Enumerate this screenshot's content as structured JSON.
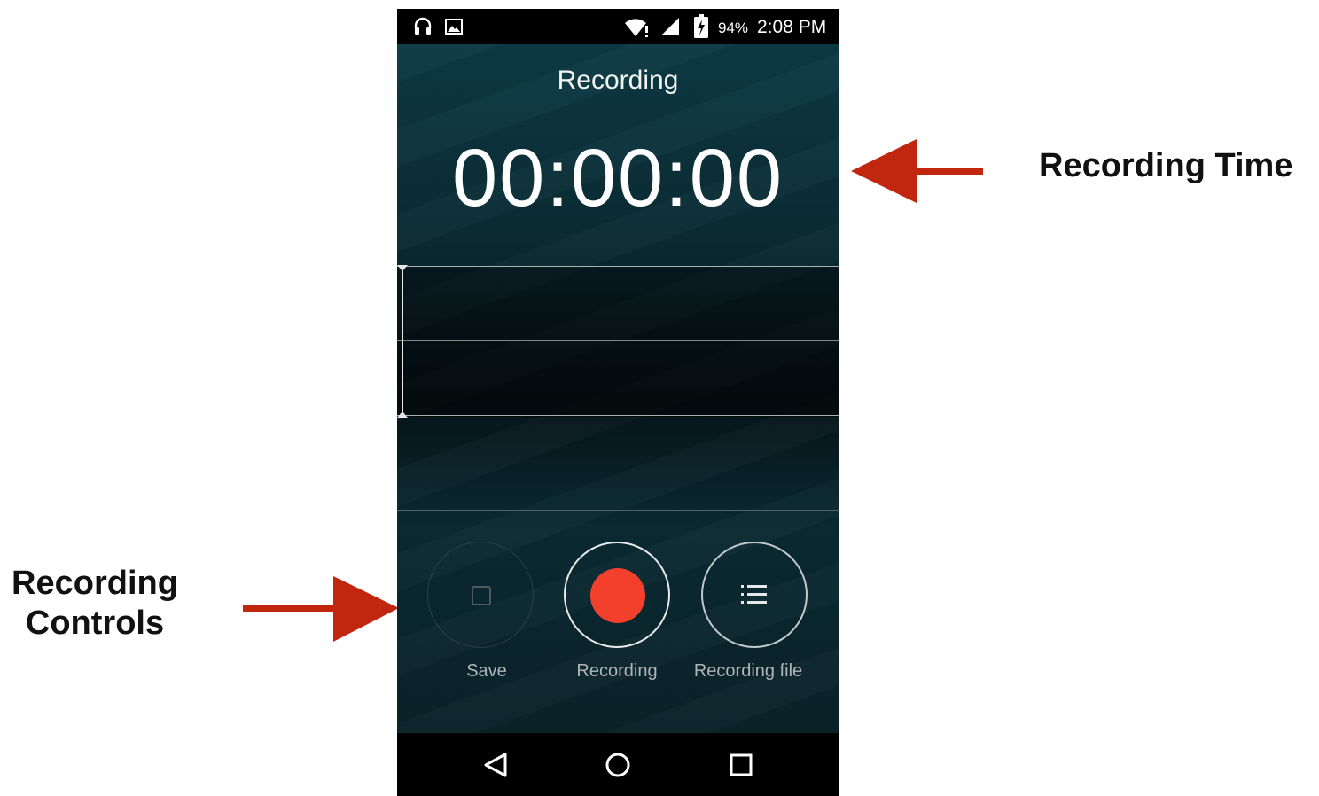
{
  "annotations": {
    "recording_time": "Recording Time",
    "recording_controls_line1": "Recording",
    "recording_controls_line2": "Controls",
    "arrow_color": "#c0270e"
  },
  "status_bar": {
    "icons_left": [
      "headset-icon",
      "image-icon"
    ],
    "icons_right": [
      "wifi-icon",
      "signal-icon",
      "battery-charging-icon"
    ],
    "battery": "94%",
    "time": "2:08 PM"
  },
  "recorder": {
    "title": "Recording",
    "timer": "00:00:00",
    "controls": [
      {
        "label": "Save",
        "icon": "stop-square-icon"
      },
      {
        "label": "Recording",
        "icon": "record-dot-icon",
        "color": "#f3402c"
      },
      {
        "label": "Recording file",
        "icon": "list-icon"
      }
    ]
  },
  "nav_bar": {
    "buttons": [
      "back-icon",
      "home-icon",
      "recents-icon"
    ]
  }
}
